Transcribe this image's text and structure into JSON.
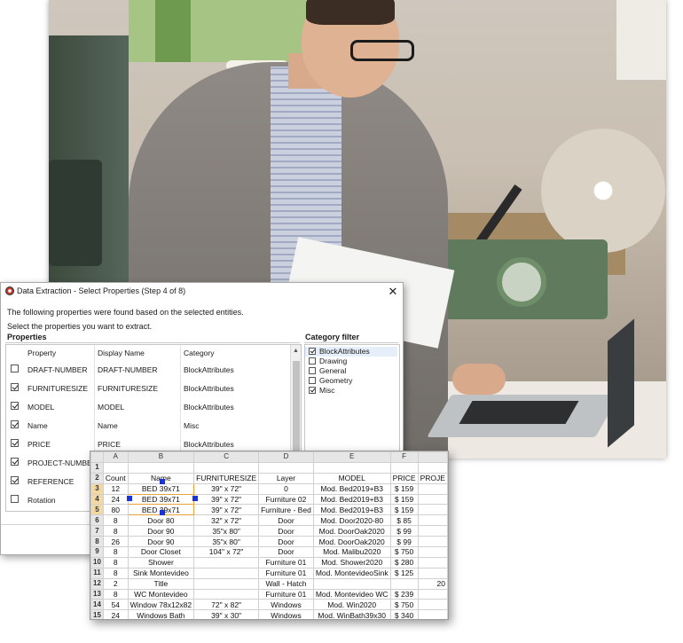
{
  "dialog": {
    "title": "Data Extraction - Select Properties (Step 4 of 8)",
    "close_glyph": "✕",
    "intro_line1": "The following properties were found based on the selected entities.",
    "intro_line2": "Select the properties you want to extract.",
    "properties_section": "Properties",
    "category_section": "Category filter",
    "columns": {
      "property": "Property",
      "display_name": "Display Name",
      "category": "Category"
    },
    "properties": [
      {
        "checked": false,
        "property": "DRAFT-NUMBER",
        "display_name": "DRAFT-NUMBER",
        "category": "BlockAttributes"
      },
      {
        "checked": true,
        "property": "FURNITURESIZE",
        "display_name": "FURNITURESIZE",
        "category": "BlockAttributes"
      },
      {
        "checked": true,
        "property": "MODEL",
        "display_name": "MODEL",
        "category": "BlockAttributes"
      },
      {
        "checked": true,
        "property": "Name",
        "display_name": "Name",
        "category": "Misc"
      },
      {
        "checked": true,
        "property": "PRICE",
        "display_name": "PRICE",
        "category": "BlockAttributes"
      },
      {
        "checked": true,
        "property": "PROJECT-NUMBER",
        "display_name": "",
        "category": ""
      },
      {
        "checked": true,
        "property": "REFERENCE",
        "display_name": "",
        "category": ""
      },
      {
        "checked": false,
        "property": "Rotation",
        "display_name": "",
        "category": ""
      }
    ],
    "categories": [
      {
        "checked": true,
        "label": "BlockAttributes"
      },
      {
        "checked": false,
        "label": "Drawing"
      },
      {
        "checked": false,
        "label": "General"
      },
      {
        "checked": false,
        "label": "Geometry"
      },
      {
        "checked": true,
        "label": "Misc"
      }
    ]
  },
  "sheet": {
    "col_letters": [
      "",
      "A",
      "B",
      "C",
      "D",
      "E",
      "F",
      ""
    ],
    "rows": [
      {
        "n": "1",
        "cells": [
          "",
          "",
          "",
          "",
          "",
          "",
          ""
        ]
      },
      {
        "n": "2",
        "cells": [
          "Count",
          "Name",
          "FURNITURESIZE",
          "Layer",
          "MODEL",
          "PRICE",
          "PROJE"
        ]
      },
      {
        "n": "3",
        "cells": [
          "12",
          "BED 39x71",
          "39\" x 72\"",
          "0",
          "Mod. Bed2019+B3",
          "$ 159",
          ""
        ]
      },
      {
        "n": "4",
        "cells": [
          "24",
          "BED 39x71",
          "39\" x 72\"",
          "Furniture 02",
          "Mod. Bed2019+B3",
          "$ 159",
          ""
        ]
      },
      {
        "n": "5",
        "cells": [
          "80",
          "BED 39x71",
          "39\" x 72\"",
          "Furniture - Bed",
          "Mod. Bed2019+B3",
          "$ 159",
          ""
        ]
      },
      {
        "n": "6",
        "cells": [
          "8",
          "Door 80",
          "32\" x 72\"",
          "Door",
          "Mod. Door2020-80",
          "$ 85",
          ""
        ]
      },
      {
        "n": "7",
        "cells": [
          "8",
          "Door 90",
          "35\"x 80\"",
          "Door",
          "Mod. DoorOak2020",
          "$ 99",
          ""
        ]
      },
      {
        "n": "8",
        "cells": [
          "26",
          "Door 90",
          "35\"x 80\"",
          "Door",
          "Mod. DoorOak2020",
          "$ 99",
          ""
        ]
      },
      {
        "n": "9",
        "cells": [
          "8",
          "Door Closet",
          "104\" x 72\"",
          "Door",
          "Mod.  Malibu2020",
          "$ 750",
          ""
        ]
      },
      {
        "n": "10",
        "cells": [
          "8",
          "Shower",
          "",
          "Furniture 01",
          "Mod. Shower2020",
          "$ 280",
          ""
        ]
      },
      {
        "n": "11",
        "cells": [
          "8",
          "Sink Montevideo",
          "",
          "Furniture 01",
          "Mod. MontevideoSink",
          "$ 125",
          ""
        ]
      },
      {
        "n": "12",
        "cells": [
          "2",
          "Title",
          "",
          "Wall - Hatch",
          "",
          "",
          "20"
        ]
      },
      {
        "n": "13",
        "cells": [
          "8",
          "WC Montevideo",
          "",
          "Furniture 01",
          "Mod. Montevideo WC",
          "$ 239",
          ""
        ]
      },
      {
        "n": "14",
        "cells": [
          "54",
          "Window 78x12x82",
          "72\" x 82\"",
          "Windows",
          "Mod. Win2020",
          "$ 750",
          ""
        ]
      },
      {
        "n": "15",
        "cells": [
          "24",
          "Windows Bath",
          "39\" x 30\"",
          "Windows",
          "Mod. WinBath39x30",
          "$ 340",
          ""
        ]
      }
    ]
  }
}
